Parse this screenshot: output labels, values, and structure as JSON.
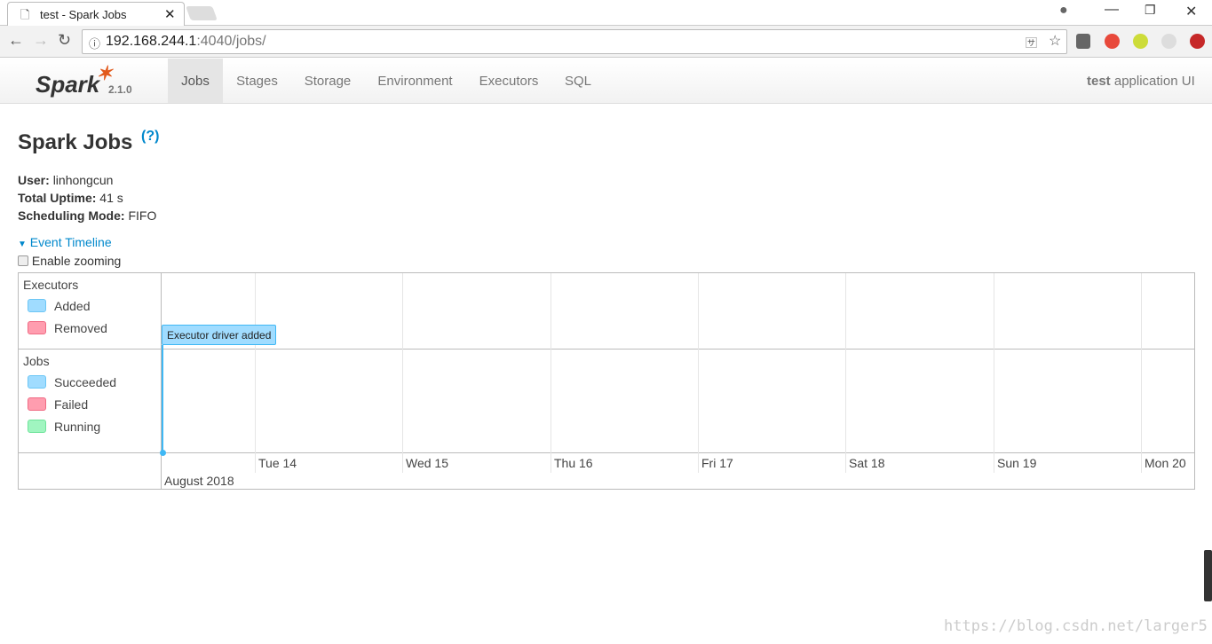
{
  "browser": {
    "tab_title": "test - Spark Jobs",
    "url_host": "192.168.244.1",
    "url_rest": ":4040/jobs/"
  },
  "nav": {
    "version": "2.1.0",
    "logo_text": "Spark",
    "items": [
      {
        "label": "Jobs",
        "active": true
      },
      {
        "label": "Stages"
      },
      {
        "label": "Storage"
      },
      {
        "label": "Environment"
      },
      {
        "label": "Executors"
      },
      {
        "label": "SQL"
      }
    ],
    "app_name": "test",
    "app_suffix": "application UI"
  },
  "page": {
    "title": "Spark Jobs",
    "help": "(?)",
    "user_label": "User:",
    "user": "linhongcun",
    "uptime_label": "Total Uptime:",
    "uptime": "41 s",
    "mode_label": "Scheduling Mode:",
    "mode": "FIFO",
    "timeline_toggle": "Event Timeline",
    "zoom_label": "Enable zooming"
  },
  "timeline": {
    "executors_title": "Executors",
    "executors_legend": [
      {
        "label": "Added",
        "color": "#a0dcff"
      },
      {
        "label": "Removed",
        "color": "#ff9daf"
      }
    ],
    "jobs_title": "Jobs",
    "jobs_legend": [
      {
        "label": "Succeeded",
        "color": "#a0dcff"
      },
      {
        "label": "Failed",
        "color": "#ff9daf"
      },
      {
        "label": "Running",
        "color": "#a0f5c0"
      }
    ],
    "event": "Executor driver added",
    "ticks": [
      "Tue 14",
      "Wed 15",
      "Thu 16",
      "Fri 17",
      "Sat 18",
      "Sun 19",
      "Mon 20"
    ],
    "month": "August 2018"
  },
  "watermark": "https://blog.csdn.net/larger5"
}
